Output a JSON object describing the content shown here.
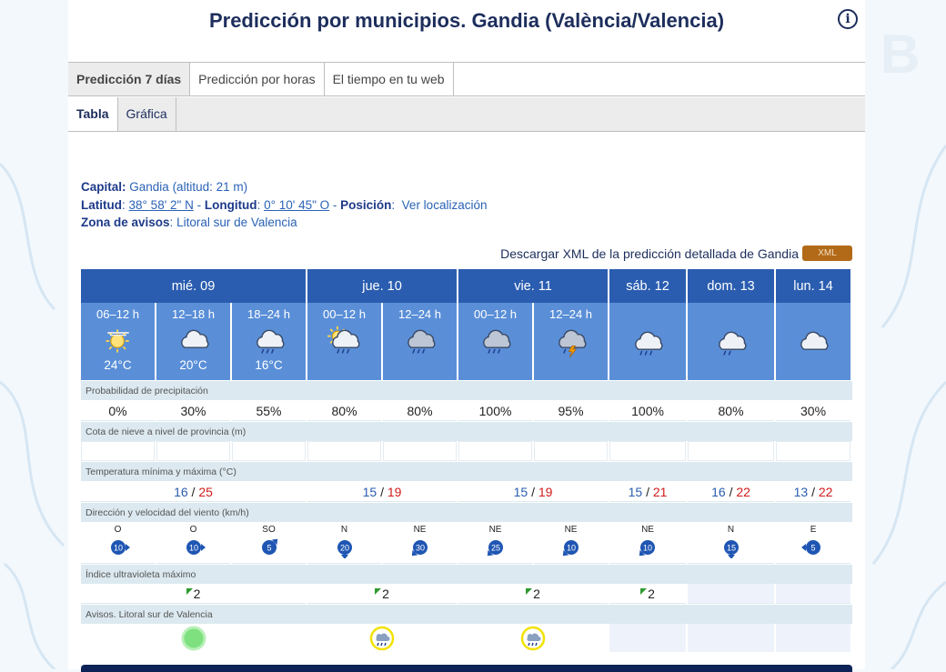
{
  "page": {
    "title": "Predicción por municipios. Gandia (València/Valencia)",
    "info_icon": "info-icon"
  },
  "tabs_primary": [
    {
      "label": "Predicción 7 días",
      "active": true
    },
    {
      "label": "Predicción por horas",
      "active": false
    },
    {
      "label": "El tiempo en tu web",
      "active": false
    }
  ],
  "tabs_secondary": [
    {
      "label": "Tabla",
      "active": true
    },
    {
      "label": "Gráfica",
      "active": false
    }
  ],
  "meta": {
    "capital_label": "Capital:",
    "capital_value": "Gandia (altitud: 21 m)",
    "latitud_label": "Latitud",
    "latitud_value": "38° 58' 2\" N",
    "longitud_label": "Longitud",
    "longitud_value": "0° 10' 45\" O",
    "posicion_label": "Posición",
    "posicion_link": "Ver localización",
    "zona_label": "Zona de avisos",
    "zona_value": "Litoral sur de Valencia"
  },
  "xml": {
    "text": "Descargar XML de la predicción detallada de Gandia",
    "badge": "XML"
  },
  "days": [
    {
      "label": "mié. 09"
    },
    {
      "label": "jue. 10"
    },
    {
      "label": "vie. 11"
    },
    {
      "label": "sáb. 12"
    },
    {
      "label": "dom. 13"
    },
    {
      "label": "lun. 14"
    }
  ],
  "periods": [
    {
      "label": "06–12 h",
      "icon": "sun-haze-icon",
      "temp": "24°C"
    },
    {
      "label": "12–18 h",
      "icon": "cloud-icon",
      "temp": "20°C"
    },
    {
      "label": "18–24 h",
      "icon": "cloud-rain-icon",
      "temp": "16°C"
    },
    {
      "label": "00–12 h",
      "icon": "sun-cloud-rain-icon",
      "temp": ""
    },
    {
      "label": "12–24 h",
      "icon": "dark-cloud-rain-icon",
      "temp": ""
    },
    {
      "label": "00–12 h",
      "icon": "dark-cloud-rain-icon",
      "temp": ""
    },
    {
      "label": "12–24 h",
      "icon": "storm-cloud-icon",
      "temp": ""
    },
    {
      "label": "",
      "icon": "cloud-rain-icon",
      "temp": ""
    },
    {
      "label": "",
      "icon": "cloud-drizzle-icon",
      "temp": ""
    },
    {
      "label": "",
      "icon": "cloud-icon",
      "temp": ""
    }
  ],
  "sections": {
    "precip": "Probabilidad de precipitación",
    "snow": "Cota de nieve a nivel de provincia (m)",
    "temp": "Temperatura mínima y máxima (°C)",
    "wind": "Dirección y velocidad del viento (km/h)",
    "uv": "Índice ultravioleta máximo",
    "warnings": "Avisos. Litoral sur de Valencia"
  },
  "precip": [
    "0%",
    "30%",
    "55%",
    "80%",
    "80%",
    "100%",
    "95%",
    "100%",
    "80%",
    "30%"
  ],
  "temps": [
    {
      "min": "16",
      "max": "25"
    },
    {
      "min": "15",
      "max": "19"
    },
    {
      "min": "15",
      "max": "19"
    },
    {
      "min": "15",
      "max": "21"
    },
    {
      "min": "16",
      "max": "22"
    },
    {
      "min": "13",
      "max": "22"
    }
  ],
  "wind": [
    {
      "dir": "O",
      "speed": "10"
    },
    {
      "dir": "O",
      "speed": "10"
    },
    {
      "dir": "SO",
      "speed": "5"
    },
    {
      "dir": "N",
      "speed": "20"
    },
    {
      "dir": "NE",
      "speed": "30"
    },
    {
      "dir": "NE",
      "speed": "25"
    },
    {
      "dir": "NE",
      "speed": "10"
    },
    {
      "dir": "NE",
      "speed": "10"
    },
    {
      "dir": "N",
      "speed": "15"
    },
    {
      "dir": "E",
      "speed": "5"
    }
  ],
  "uv": [
    "2",
    "2",
    "2",
    "2",
    "",
    ""
  ],
  "warnings": [
    {
      "level": "green",
      "icon": "no-warning-icon"
    },
    {
      "level": "yellow",
      "icon": "rain-warning-icon"
    },
    {
      "level": "yellow",
      "icon": "rain-warning-icon"
    },
    {
      "level": "",
      "icon": ""
    },
    {
      "level": "",
      "icon": ""
    },
    {
      "level": "",
      "icon": ""
    }
  ],
  "colors": {
    "header_blue": "#2a5db0",
    "period_blue": "#5a8fd8",
    "min_temp": "#2a5db0",
    "max_temp": "#d11b1b",
    "wind_badge": "#1f56b3",
    "xml_badge": "#b26a18",
    "warning_green": "#7ee07e",
    "warning_yellow": "#f2e200"
  }
}
